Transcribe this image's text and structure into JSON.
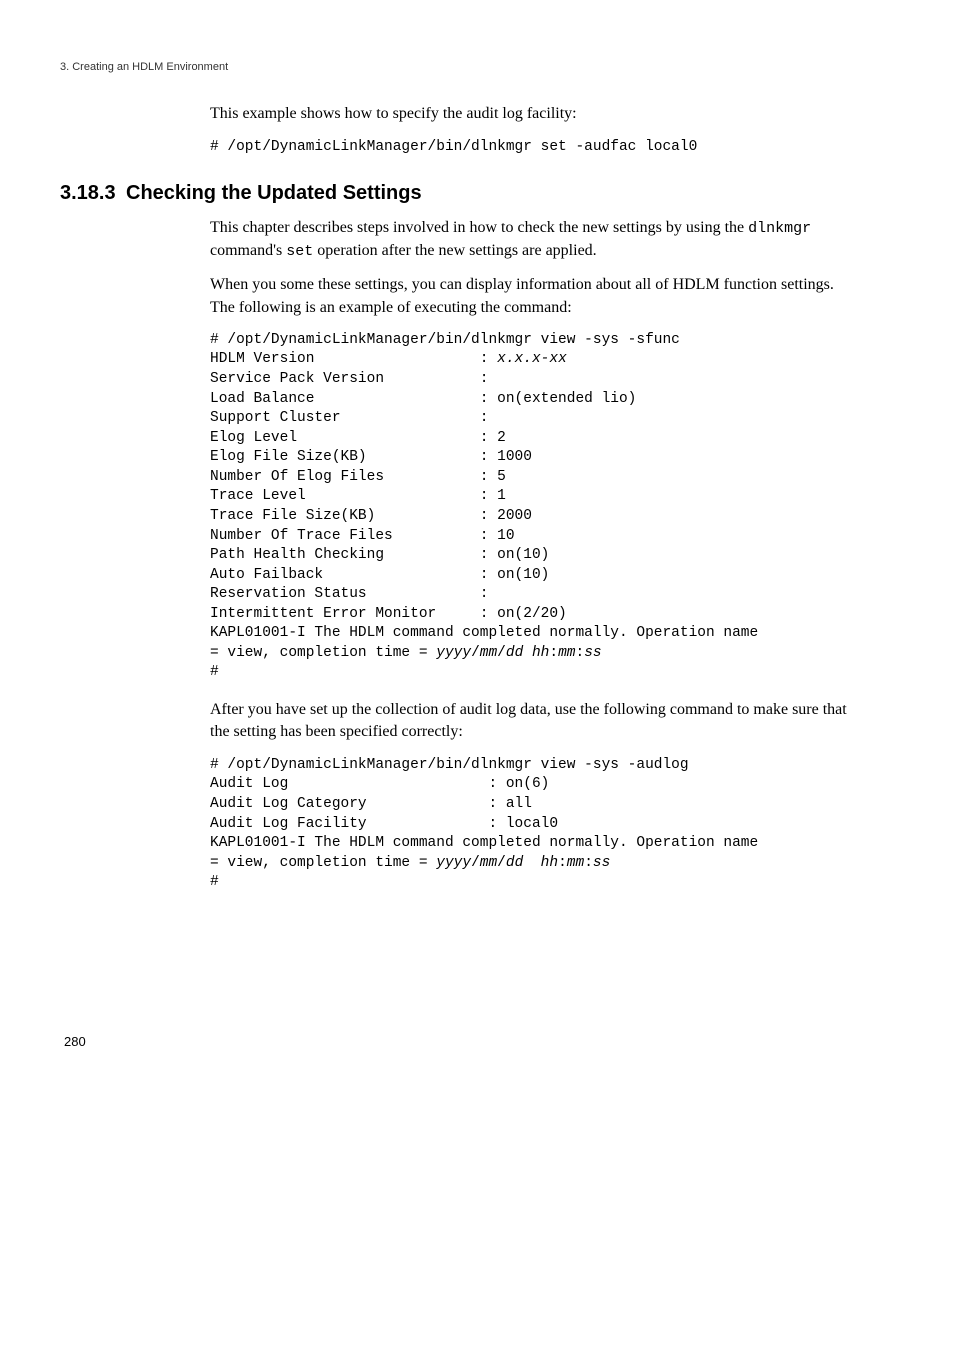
{
  "header": {
    "running_head": "3. Creating an HDLM Environment"
  },
  "intro": {
    "para1": "This example shows how to specify the audit log facility:",
    "code1": "# /opt/DynamicLinkManager/bin/dlnkmgr set -audfac local0"
  },
  "section": {
    "number": "3.18.3",
    "title": "Checking the Updated Settings",
    "para1_a": "This chapter describes steps involved in how to check the new settings by using the ",
    "para1_code1": "dlnkmgr",
    "para1_b": " command's ",
    "para1_code2": "set",
    "para1_c": " operation after the new settings are applied.",
    "para2": "When you some these settings, you can display information about all of HDLM function settings. The following is an example of executing the command:",
    "code2": {
      "line1": "# /opt/DynamicLinkManager/bin/dlnkmgr view -sys -sfunc",
      "line2a": "HDLM Version                   : ",
      "line2b": "x.x.x-xx",
      "line3": "Service Pack Version           : ",
      "line4": "Load Balance                   : on(extended lio)",
      "line5": "Support Cluster                : ",
      "line6": "Elog Level                     : 2",
      "line7": "Elog File Size(KB)             : 1000",
      "line8": "Number Of Elog Files           : 5",
      "line9": "Trace Level                    : 1",
      "line10": "Trace File Size(KB)            : 2000",
      "line11": "Number Of Trace Files          : 10",
      "line12": "Path Health Checking           : on(10)",
      "line13": "Auto Failback                  : on(10)",
      "line14": "Reservation Status             : ",
      "line15": "Intermittent Error Monitor     : on(2/20)",
      "line16": "KAPL01001-I The HDLM command completed normally. Operation name ",
      "line17a": "= view, completion time = ",
      "line17b": "yyyy",
      "line17c": "/",
      "line17d": "mm",
      "line17e": "/",
      "line17f": "dd hh",
      "line17g": ":",
      "line17h": "mm",
      "line17i": ":",
      "line17j": "ss",
      "line18": "#"
    },
    "para3": "After you have set up the collection of audit log data, use the following command to make sure that the setting has been specified correctly:",
    "code3": {
      "line1": "# /opt/DynamicLinkManager/bin/dlnkmgr view -sys -audlog",
      "line2": "Audit Log                       : on(6)",
      "line3": "Audit Log Category              : all",
      "line4": "Audit Log Facility              : local0",
      "line5": "KAPL01001-I The HDLM command completed normally. Operation name ",
      "line6a": "= view, completion time = ",
      "line6b": "yyyy",
      "line6c": "/",
      "line6d": "mm",
      "line6e": "/",
      "line6f": "dd  hh",
      "line6g": ":",
      "line6h": "mm",
      "line6i": ":",
      "line6j": "ss",
      "line7": "#"
    }
  },
  "footer": {
    "page_number": "280"
  }
}
